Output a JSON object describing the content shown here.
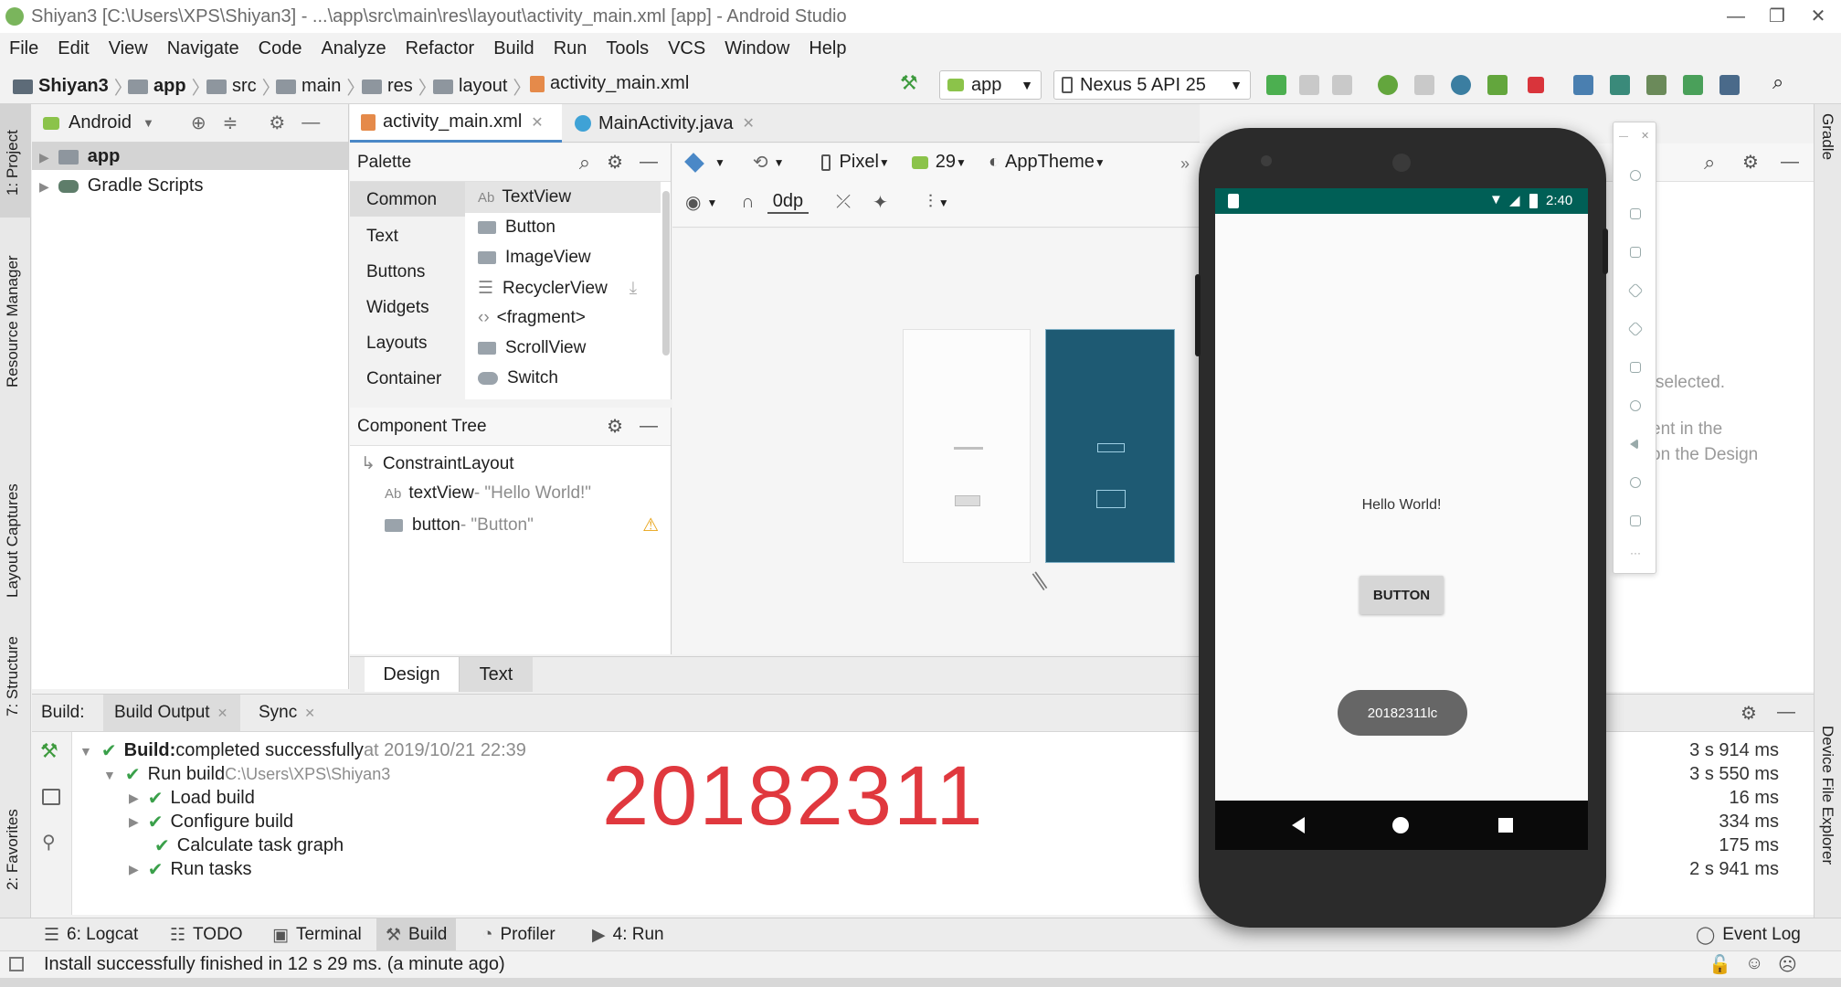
{
  "window": {
    "title": "Shiyan3 [C:\\Users\\XPS\\Shiyan3] - ...\\app\\src\\main\\res\\layout\\activity_main.xml [app] - Android Studio"
  },
  "menu": [
    "File",
    "Edit",
    "View",
    "Navigate",
    "Code",
    "Analyze",
    "Refactor",
    "Build",
    "Run",
    "Tools",
    "VCS",
    "Window",
    "Help"
  ],
  "breadcrumbs": [
    "Shiyan3",
    "app",
    "src",
    "main",
    "res",
    "layout",
    "activity_main.xml"
  ],
  "toolbar": {
    "config": "app",
    "device": "Nexus 5 API 25"
  },
  "left_tools": {
    "project": "1: Project",
    "resource_manager": "Resource Manager",
    "layout_captures": "Layout Captures",
    "structure": "7: Structure",
    "favorites": "2: Favorites"
  },
  "right_tools": {
    "gradle": "Gradle",
    "device_explorer": "Device File Explorer"
  },
  "project_panel": {
    "view_mode": "Android",
    "nodes": [
      "app",
      "Gradle Scripts"
    ]
  },
  "editor_tabs": [
    "activity_main.xml",
    "MainActivity.java"
  ],
  "palette": {
    "title": "Palette",
    "categories": [
      "Common",
      "Text",
      "Buttons",
      "Widgets",
      "Layouts",
      "Container"
    ],
    "items": [
      "TextView",
      "Button",
      "ImageView",
      "RecyclerView",
      "<fragment>",
      "ScrollView",
      "Switch"
    ]
  },
  "component_tree": {
    "title": "Component Tree",
    "root": "ConstraintLayout",
    "children": [
      {
        "name": "textView",
        "label": "- \"Hello World!\""
      },
      {
        "name": "button",
        "label": "- \"Button\""
      }
    ]
  },
  "design_toolbar": {
    "device": "Pixel",
    "api": "29",
    "theme": "AppTheme",
    "margin": "0dp"
  },
  "design_tabs": [
    "Design",
    "Text"
  ],
  "attributes_hint": [
    "selected.",
    "ent in the",
    "on the Design"
  ],
  "build": {
    "tabs": [
      "Build:",
      "Build Output",
      "Sync"
    ],
    "lines": [
      {
        "label": "Build:",
        "text": " completed successfully",
        "suffix": " at 2019/10/21 22:39",
        "duration": "3 s 914 ms"
      },
      {
        "label": "Run build",
        "suffix": " C:\\Users\\XPS\\Shiyan3",
        "duration": "3 s 550 ms"
      },
      {
        "label": "Load build",
        "duration": "16 ms"
      },
      {
        "label": "Configure build",
        "duration": "334 ms"
      },
      {
        "label": "Calculate task graph",
        "duration": "175 ms"
      },
      {
        "label": "Run tasks",
        "duration": "2 s 941 ms"
      }
    ],
    "overlay_number": "20182311"
  },
  "bottom_tools": [
    "6: Logcat",
    "TODO",
    "Terminal",
    "Build",
    "Profiler",
    "4: Run"
  ],
  "event_log": "Event Log",
  "status": "Install successfully finished in 12 s 29 ms. (a minute ago)",
  "emulator": {
    "time": "2:40",
    "text": "Hello World!",
    "button": "BUTTON",
    "toast": "20182311lc"
  },
  "colors": {
    "accent_green": "#3aa04a",
    "status_teal": "#005f56",
    "blueprint": "#1e5a73",
    "overlay_red": "#e0383e"
  }
}
